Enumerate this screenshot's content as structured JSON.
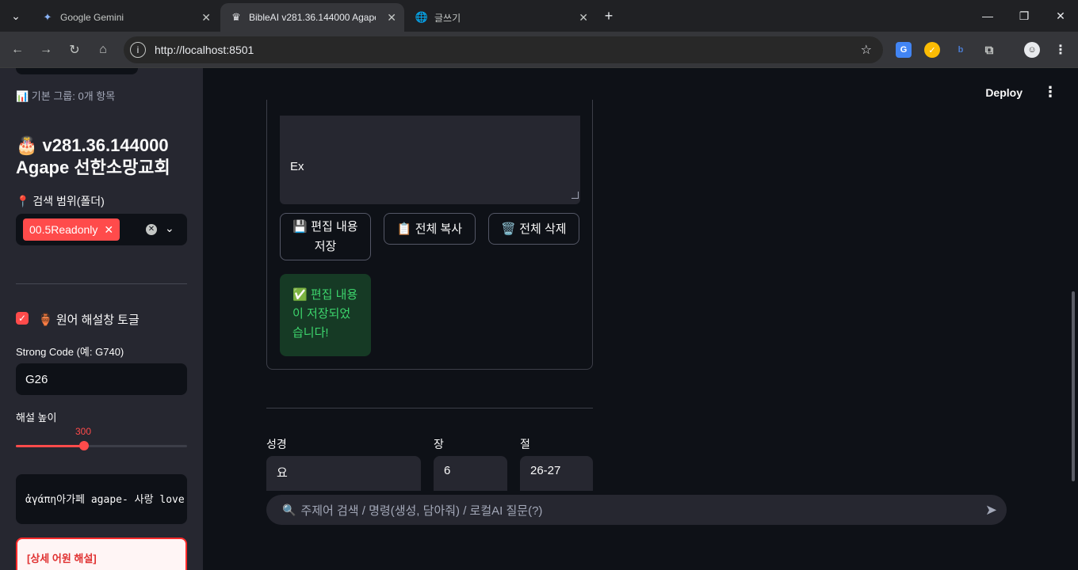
{
  "browser": {
    "tabs": [
      {
        "label": "Google Gemini",
        "icon": "gemini-icon"
      },
      {
        "label": "BibleAI v281.36.144000 Agape",
        "icon": "streamlit-crown-icon"
      },
      {
        "label": "글쓰기",
        "icon": "globe-icon"
      }
    ],
    "url": "http://localhost:8501"
  },
  "sidebar": {
    "group_text": "📊 기본 그룹: 0개 항목",
    "version_title": "🎂 v281.36.144000 Agape 선한소망교회",
    "search_scope_label": "📍 검색 범위(폴더)",
    "selected_folder": "00.5Readonly",
    "toggle_label": "🏺 원어 해설창 토글",
    "toggle_checked": true,
    "strong_code_label": "Strong Code (예: G740)",
    "strong_code_value": "G26",
    "height_label": "해설 높이",
    "height_value": "300",
    "height_fraction": 0.4,
    "code_text": "ἀγάπη아가페 agape- 사랑 love",
    "detail_title": "[상세 어원 해설]"
  },
  "header": {
    "deploy_label": "Deploy"
  },
  "editor": {
    "textarea_text": "Ex",
    "save_button": "💾 편집 내용 저장",
    "copy_button": "📋 전체 복사",
    "delete_button": "🗑️ 전체 삭제",
    "success_message": "✅ 편집 내용이 저장되었습니다!"
  },
  "lookup": {
    "book_label": "성경",
    "book_value": "요",
    "chapter_label": "장",
    "chapter_value": "6",
    "verse_label": "절",
    "verse_value": "26-27"
  },
  "chat": {
    "placeholder": "주제어 검색 / 명령(생성, 담아줘) / 로컬AI 질문(?)"
  },
  "colors": {
    "accent": "#ff4b4b",
    "success": "#3dd56d",
    "background": "#0e1117",
    "sidebar": "#262730"
  }
}
